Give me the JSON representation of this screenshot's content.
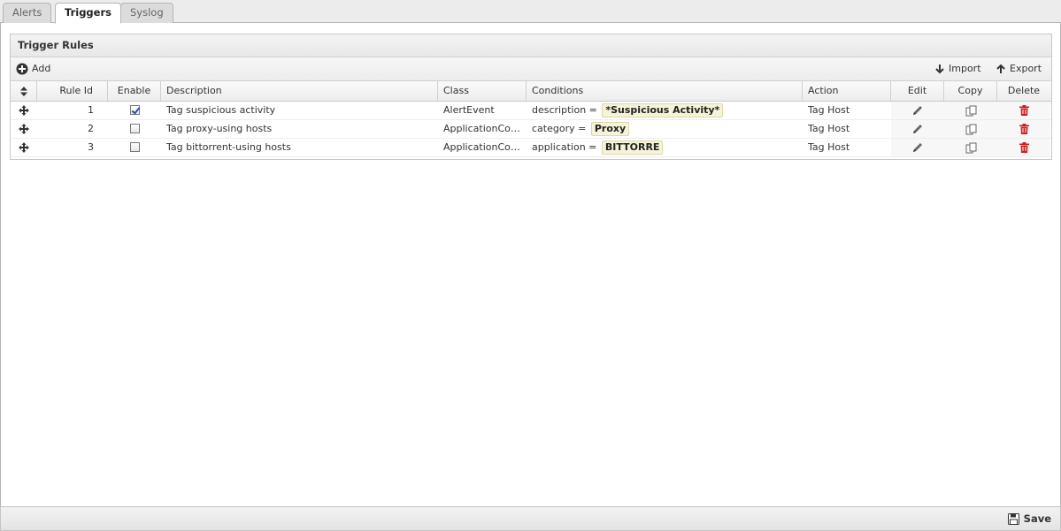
{
  "tabs": [
    {
      "label": "Alerts",
      "active": false
    },
    {
      "label": "Triggers",
      "active": true
    },
    {
      "label": "Syslog",
      "active": false
    }
  ],
  "panel": {
    "title": "Trigger Rules"
  },
  "toolbar": {
    "add_label": "Add",
    "import_label": "Import",
    "export_label": "Export"
  },
  "grid": {
    "headers": {
      "rule_id": "Rule Id",
      "enable": "Enable",
      "description": "Description",
      "class": "Class",
      "conditions": "Conditions",
      "action": "Action",
      "edit": "Edit",
      "copy": "Copy",
      "delete": "Delete"
    },
    "rows": [
      {
        "rule_id": "1",
        "enabled": true,
        "description": "Tag suspicious activity",
        "class": "AlertEvent",
        "condition_field": "description =",
        "condition_value": "*Suspicious Activity*",
        "action": "Tag Host"
      },
      {
        "rule_id": "2",
        "enabled": false,
        "description": "Tag proxy-using hosts",
        "class": "ApplicationControlLogEvent",
        "condition_field": "category =",
        "condition_value": "Proxy",
        "action": "Tag Host"
      },
      {
        "rule_id": "3",
        "enabled": false,
        "description": "Tag bittorrent-using hosts",
        "class": "ApplicationControlLogEvent",
        "condition_field": "application =",
        "condition_value": "BITTORRE",
        "action": "Tag Host"
      }
    ]
  },
  "footer": {
    "save_label": "Save"
  },
  "colors": {
    "delete_icon": "#cc1f1f",
    "condition_bg": "#f5f3d8",
    "checkbox_check": "#2c4fa8"
  }
}
